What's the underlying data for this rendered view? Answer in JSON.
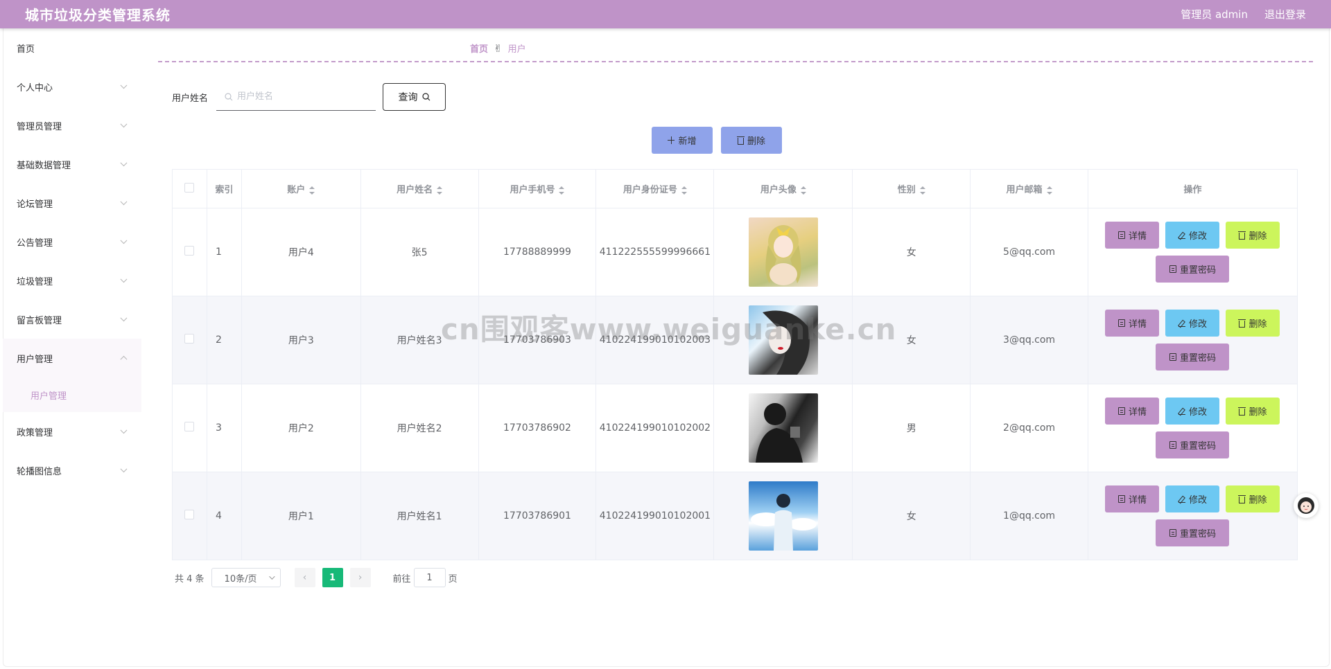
{
  "header": {
    "title": "城市垃圾分类管理系统",
    "user_label": "管理员 admin",
    "logout": "退出登录"
  },
  "sidebar": {
    "items": [
      {
        "label": "首页"
      },
      {
        "label": "个人中心"
      },
      {
        "label": "管理员管理"
      },
      {
        "label": "基础数据管理"
      },
      {
        "label": "论坛管理"
      },
      {
        "label": "公告管理"
      },
      {
        "label": "垃圾管理"
      },
      {
        "label": "留言板管理"
      },
      {
        "label": "用户管理"
      },
      {
        "label": "政策管理"
      },
      {
        "label": "轮播图信息"
      }
    ],
    "sub_item": "用户管理"
  },
  "breadcrumb": {
    "home": "首页",
    "current": "用户"
  },
  "search": {
    "label": "用户姓名",
    "placeholder": "用户姓名",
    "button": "查询"
  },
  "actions": {
    "add": "新增",
    "delete": "删除"
  },
  "table": {
    "headers": [
      "索引",
      "账户",
      "用户姓名",
      "用户手机号",
      "用户身份证号",
      "用户头像",
      "性别",
      "用户邮箱",
      "操作"
    ],
    "rows": [
      {
        "index": "1",
        "account": "用户4",
        "name": "张5",
        "phone": "17788889999",
        "id_card": "411222555599996661",
        "gender": "女",
        "email": "5@qq.com"
      },
      {
        "index": "2",
        "account": "用户3",
        "name": "用户姓名3",
        "phone": "17703786903",
        "id_card": "410224199010102003",
        "gender": "女",
        "email": "3@qq.com"
      },
      {
        "index": "3",
        "account": "用户2",
        "name": "用户姓名2",
        "phone": "17703786902",
        "id_card": "410224199010102002",
        "gender": "男",
        "email": "2@qq.com"
      },
      {
        "index": "4",
        "account": "用户1",
        "name": "用户姓名1",
        "phone": "17703786901",
        "id_card": "410224199010102001",
        "gender": "女",
        "email": "1@qq.com"
      }
    ],
    "ops": {
      "detail": "详情",
      "edit": "修改",
      "remove": "删除",
      "reset": "重置密码"
    }
  },
  "pagination": {
    "total": "共 4 条",
    "page_size": "10条/页",
    "current": "1",
    "goto_prefix": "前往",
    "goto_value": "1",
    "goto_suffix": "页"
  },
  "watermark": "cn围观客www.weiguanke.cn",
  "colors": {
    "primary": "#bf93c8",
    "action": "#8fa3ea",
    "edit": "#6dc8f2",
    "remove": "#ccf55c",
    "page_active": "#17b978"
  }
}
